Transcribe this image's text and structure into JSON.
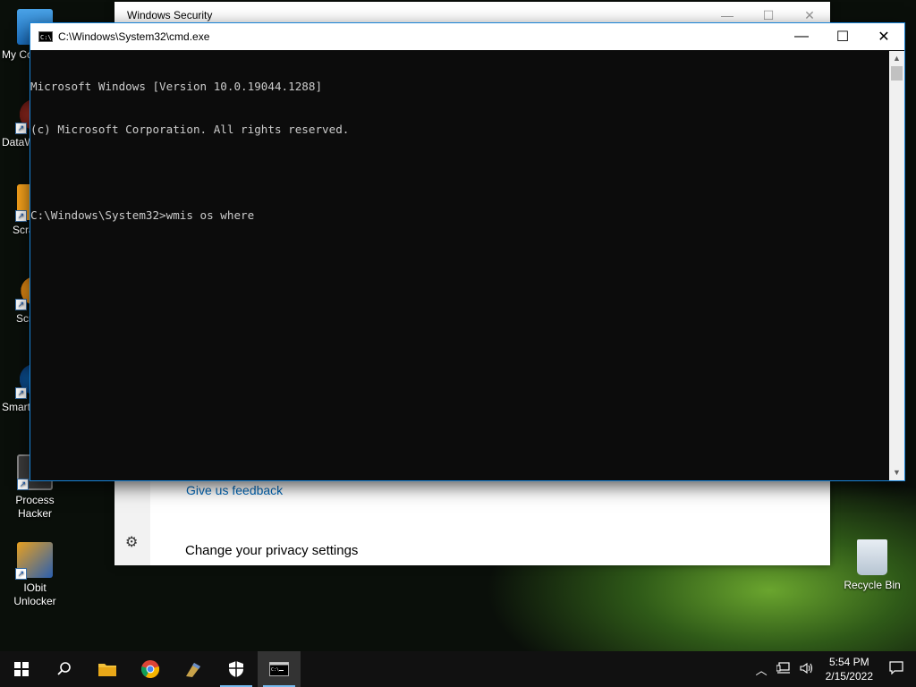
{
  "desktop": {
    "icons": [
      {
        "label": "My Co",
        "icon": "computer-icon"
      },
      {
        "label": "DataW",
        "icon": "datawrapper-icon"
      },
      {
        "label": "Scra",
        "icon": "scratch-icon"
      },
      {
        "label": "Scr",
        "icon": "scratch-cat-icon"
      },
      {
        "label": "Smart",
        "icon": "smart-defrag-icon"
      },
      {
        "label": "Process Hacker",
        "icon": "process-hacker-icon"
      },
      {
        "label": "IObit Unlocker",
        "icon": "unlocker-icon"
      }
    ],
    "recycle_bin": {
      "label": "Recycle Bin",
      "icon": "recycle-bin-icon"
    }
  },
  "security_window": {
    "title": "Windows Security",
    "feedback_link": "Give us feedback",
    "privacy_link": "Change your privacy settings",
    "gear_icon": "⚙"
  },
  "cmd_window": {
    "title": "C:\\Windows\\System32\\cmd.exe",
    "lines": [
      "Microsoft Windows [Version 10.0.19044.1288]",
      "(c) Microsoft Corporation. All rights reserved.",
      "",
      "C:\\Windows\\System32>wmis os where"
    ],
    "minimize": "—",
    "maximize": "☐",
    "close": "✕"
  },
  "taskbar": {
    "apps": [
      {
        "name": "start",
        "icon": "windows-logo-icon"
      },
      {
        "name": "search",
        "icon": "search-icon"
      },
      {
        "name": "file-explorer",
        "icon": "folder-icon"
      },
      {
        "name": "chrome",
        "icon": "chrome-icon"
      },
      {
        "name": "app",
        "icon": "app-icon"
      },
      {
        "name": "windows-security",
        "icon": "shield-icon"
      },
      {
        "name": "cmd",
        "icon": "cmd-icon"
      }
    ],
    "clock": {
      "time": "5:54 PM",
      "date": "2/15/2022"
    }
  }
}
